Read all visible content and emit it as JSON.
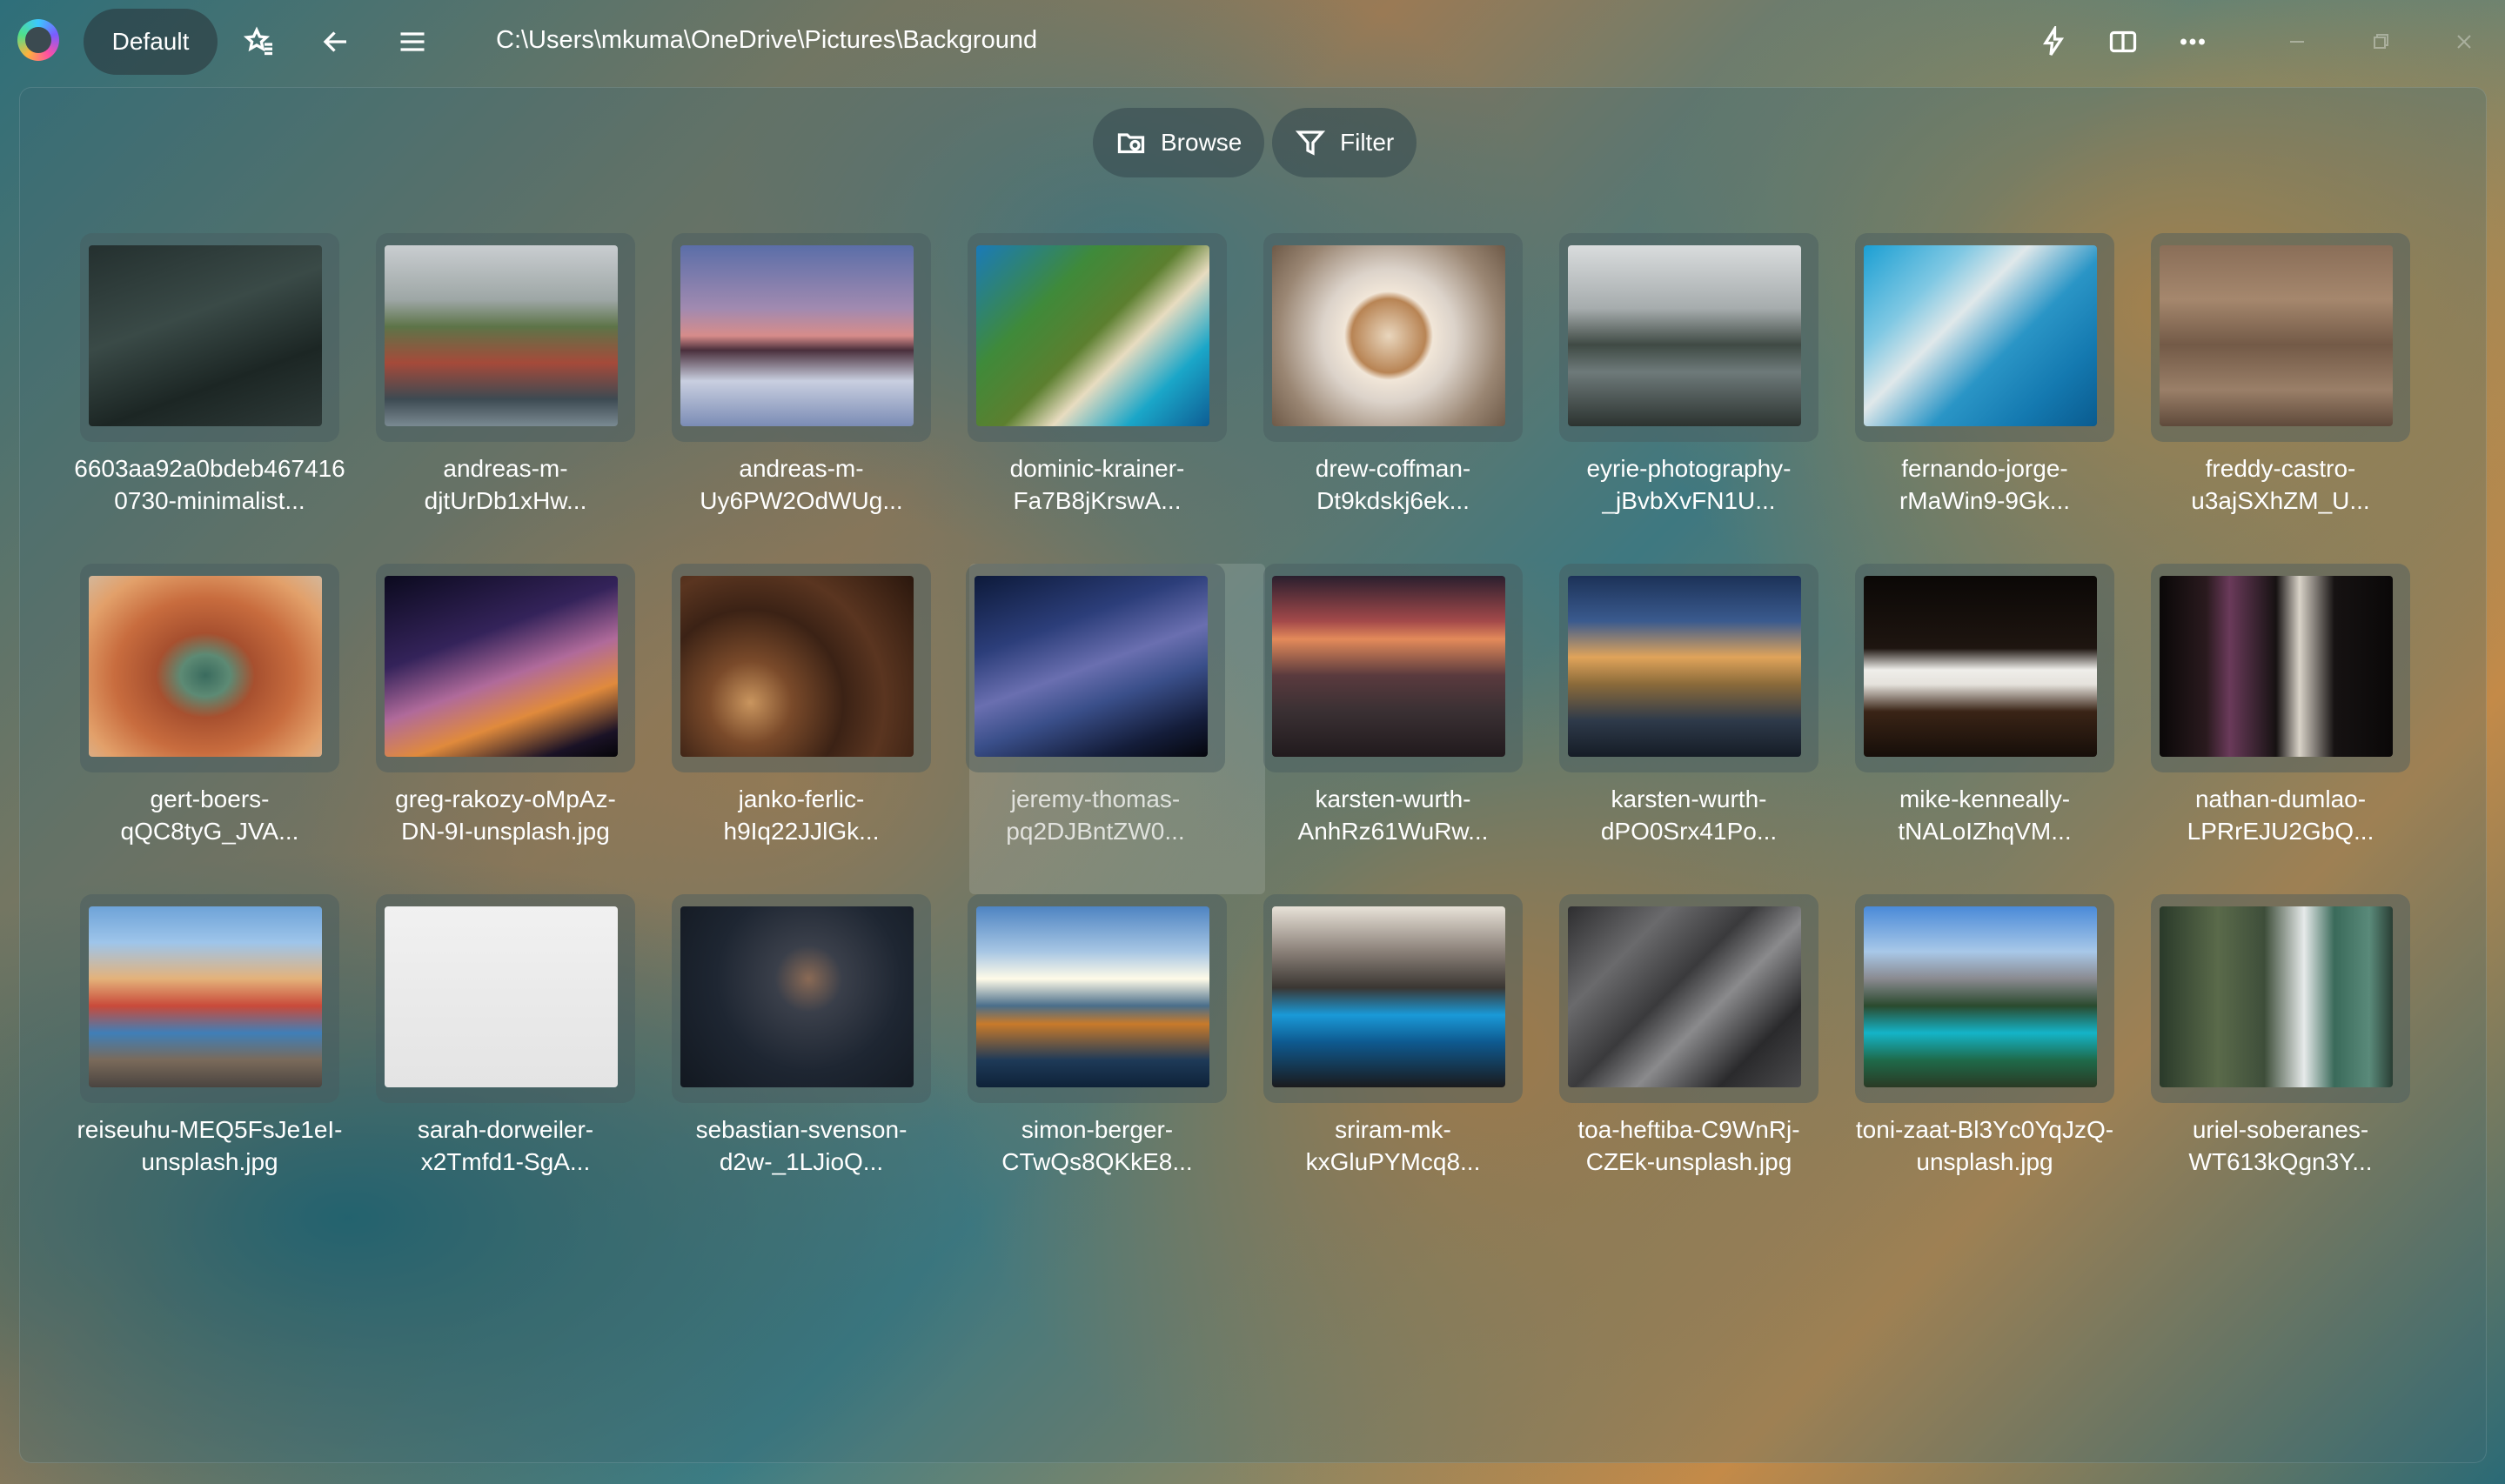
{
  "titlebar": {
    "app_logo": "app-logo",
    "profile_label": "Default",
    "path": "C:\\Users\\mkuma\\OneDrive\\Pictures\\Background",
    "icons": [
      "favorites-icon",
      "back-icon",
      "menu-icon",
      "flash-icon",
      "split-view-icon",
      "more-icon",
      "minimize-icon",
      "maximize-icon",
      "close-icon"
    ]
  },
  "toolbar": {
    "browse_label": "Browse",
    "filter_label": "Filter"
  },
  "files": [
    {
      "line1": "6603aa92a0bdeb467416",
      "line2": "0730-minimalist...",
      "thumb": "linear-gradient(160deg,#24302f 0%,#3a4a47 40%,#1c2624 70%,#2e3a38 100%)",
      "accent": "#6f8583"
    },
    {
      "line1": "andreas-m-",
      "line2": "djtUrDb1xHw...",
      "thumb": "linear-gradient(180deg,#c9cdd0 0%,#9ea7a6 30%,#5d7448 45%,#a54a3a 65%,#3d4a52 85%,#7a8a92 100%)",
      "accent": "#b8553e"
    },
    {
      "line1": "andreas-m-",
      "line2": "Uy6PW2OdWUg...",
      "thumb": "linear-gradient(180deg,#5b6ea8 0%,#a18ab0 35%,#d78c8a 50%,#4a2f3c 58%,#c9cfe0 75%,#7b8cb5 100%)",
      "accent": "#d7d9e6"
    },
    {
      "line1": "dominic-krainer-",
      "line2": "Fa7B8jKrswA...",
      "thumb": "linear-gradient(135deg,#1a7ab8 0%,#3f8a3a 30%,#5c7f2f 50%,#e8dcc0 62%,#1aa6c8 80%,#0e5d94 100%)",
      "accent": "#3f8a3a"
    },
    {
      "line1": "drew-coffman-",
      "line2": "Dt9kdskj6ek...",
      "thumb": "radial-gradient(circle at 50% 50%,#e9d6bd 0%,#b88454 25%,#f1e6d8 30%,#dcd3ca 45%,#9a8673 75%,#6e5a48 100%)",
      "accent": "#b88454"
    },
    {
      "line1": "eyrie-photography-",
      "line2": "_jBvbXvFN1U...",
      "thumb": "linear-gradient(180deg,#d9dcdd 0%,#a6acad 35%,#3f4a44 55%,#6e7a7a 70%,#2c3330 100%)",
      "accent": "#3f4a44"
    },
    {
      "line1": "fernando-jorge-",
      "line2": "rMaWin9-9Gk...",
      "thumb": "linear-gradient(135deg,#1b9fd3 0%,#7fc8e3 25%,#e0e8ea 40%,#2a95c6 60%,#1479b0 80%,#0a5b8f 100%)",
      "accent": "#1b9fd3"
    },
    {
      "line1": "freddy-castro-",
      "line2": "u3ajSXhZM_U...",
      "thumb": "linear-gradient(180deg,#8a6e58 0%,#a5876d 30%,#735a47 55%,#9a7f68 80%,#5f4a3b 100%)",
      "accent": "#f1ece4"
    },
    {
      "line1": "gert-boers-",
      "line2": "qQC8tyG_JVA...",
      "thumb": "radial-gradient(ellipse at 50% 55%,#3a6b5e 0%,#5d8a74 15%,#a7502f 30%,#c86c3e 55%,#e2a06a 80%,#d4b79a 100%)",
      "accent": "#c86c3e"
    },
    {
      "line1": "greg-rakozy-oMpAz-",
      "line2": "DN-9I-unsplash.jpg",
      "thumb": "linear-gradient(160deg,#0b0a1e 0%,#34235a 35%,#b06a9a 55%,#e08a3c 72%,#1a1226 90%,#050508 100%)",
      "accent": "#b06a9a"
    },
    {
      "line1": "janko-ferlic-",
      "line2": "h9Iq22JJlGk...",
      "thumb": "radial-gradient(circle at 30% 70%,#c9955e 0%,#7a4a2a 20%,#3b2215 45%,#5a3520 65%,#2a170d 100%)",
      "accent": "#7a4a2a"
    },
    {
      "line1": "jeremy-thomas-",
      "line2": "pq2DJBntZW0...",
      "thumb": "linear-gradient(160deg,#0d1a3a 0%,#2c3e7a 30%,#6a6fb0 50%,#3a4f8a 65%,#141d3a 85%,#05060c 100%)",
      "accent": "#6a6fb0"
    },
    {
      "line1": "karsten-wurth-",
      "line2": "AnhRz61WuRw...",
      "thumb": "linear-gradient(180deg,#2a1f2e 0%,#a3494a 25%,#e38a5a 35%,#5a3a3e 55%,#3a3033 75%,#211a1d 100%)",
      "accent": "#e38a5a"
    },
    {
      "line1": "karsten-wurth-",
      "line2": "dPO0Srx41Po...",
      "thumb": "linear-gradient(180deg,#1c3258 0%,#3a5a8e 25%,#e0a45a 45%,#8a6a3a 60%,#2e3a4a 80%,#151c26 100%)",
      "accent": "#e0a45a"
    },
    {
      "line1": "mike-kenneally-",
      "line2": "tNALoIZhqVM...",
      "thumb": "linear-gradient(180deg,#0b0806 0%,#1e1510 40%,#efeeea 52%,#e5e2dc 60%,#3a2416 75%,#160e09 100%)",
      "accent": "#efeeea"
    },
    {
      "line1": "nathan-dumlao-",
      "line2": "LPRrEJU2GbQ...",
      "thumb": "linear-gradient(90deg,#0a0808 0%,#2a1a1e 20%,#6a3a5a 30%,#161212 50%,#d9d3c8 60%,#161212 75%,#0a0808 100%)",
      "accent": "#6a3a5a"
    },
    {
      "line1": "reiseuhu-MEQ5FsJe1eI-",
      "line2": "unsplash.jpg",
      "thumb": "linear-gradient(180deg,#6ea3d8 0%,#9ec5ea 20%,#e4b27a 40%,#c94a3a 55%,#3f7fb8 70%,#7a6a5a 85%,#4a4440 100%)",
      "accent": "#c94a3a"
    },
    {
      "line1": "sarah-dorweiler-",
      "line2": "x2Tmfd1-SgA...",
      "thumb": "linear-gradient(180deg,#f1f1f1 0%,#eaeaea 50%,#e4e4e4 100%)",
      "accent": "#2f6a3a"
    },
    {
      "line1": "sebastian-svenson-",
      "line2": "d2w-_1LJioQ...",
      "thumb": "radial-gradient(circle at 55% 40%,#8a6a55 0%,#3a3f4a 20%,#1e2632 55%,#121820 100%)",
      "accent": "#f2d24a"
    },
    {
      "line1": "simon-berger-",
      "line2": "CTwQs8QKkE8...",
      "thumb": "linear-gradient(180deg,#4e84c2 0%,#a7c6e4 25%,#fffbe8 40%,#4a6e8a 55%,#c87a2a 65%,#1e3a58 85%,#0e2238 100%)",
      "accent": "#c87a2a"
    },
    {
      "line1": "sriram-mk-",
      "line2": "kxGluPYMcq8...",
      "thumb": "linear-gradient(180deg,#e8e2d8 0%,#8a8078 25%,#3a3632 45%,#1a9ad8 60%,#0e5a90 75%,#1a1a1c 100%)",
      "accent": "#1a9ad8"
    },
    {
      "line1": "toa-heftiba-C9WnRj-",
      "line2": "CZEk-unsplash.jpg",
      "thumb": "linear-gradient(135deg,#2e2e30 0%,#6a6a6c 25%,#3a3a3c 45%,#8a8a8c 60%,#2a2a2c 80%,#4a4a4c 100%)",
      "accent": "#d9c08a"
    },
    {
      "line1": "toni-zaat-Bl3Yc0YqJzQ-",
      "line2": "unsplash.jpg",
      "thumb": "linear-gradient(180deg,#4a8ad8 0%,#a8c8e8 25%,#8a8a90 40%,#2a4a2e 55%,#14b4c8 70%,#1e6a4a 85%,#2a3a24 100%)",
      "accent": "#14b4c8"
    },
    {
      "line1": "uriel-soberanes-",
      "line2": "WT613kQgn3Y...",
      "thumb": "linear-gradient(90deg,#2a3a2a 0%,#5a6a4a 25%,#3e4e3a 45%,#e6eaea 62%,#3a6a5a 75%,#5a8a7a 90%,#2a3e34 100%)",
      "accent": "#e6eaea"
    }
  ]
}
